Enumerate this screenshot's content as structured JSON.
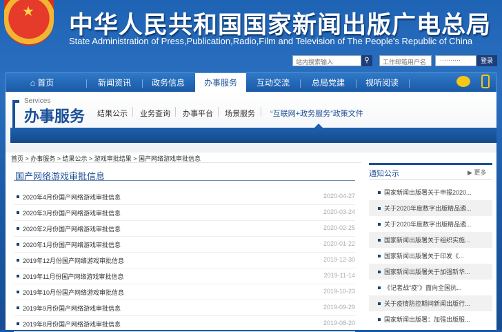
{
  "header": {
    "title_cn": "中华人民共和国国家新闻出版广电总局",
    "title_en": "State Administration of Press,Publication,Radio,Film and Television of The People's Republic of China",
    "search_placeholder": "站内搜索输入",
    "username_placeholder": "工作邮箱用户名",
    "password_value": "··········",
    "login_label": "登录",
    "search_icon": "search-icon"
  },
  "nav": {
    "home": "首页",
    "items": [
      "新闻资讯",
      "政务信息",
      "办事服务",
      "互动交流",
      "总局党建",
      "视听阅读"
    ],
    "active": "办事服务"
  },
  "services": {
    "en": "Services",
    "cn": "办事服务",
    "links": [
      "结果公示",
      "业务查询",
      "办事平台",
      "场景服务",
      "“互联网+政务服务”政策文件"
    ]
  },
  "breadcrumb": "首页 > 办事服务 > 结果公示 > 游戏审批结果 > 国产网络游戏审批信息",
  "main": {
    "title": "国产网络游戏审批信息",
    "items": [
      {
        "title": "2020年4月份国产网络游戏审批信息",
        "date": "2020-04-27"
      },
      {
        "title": "2020年3月份国产网络游戏审批信息",
        "date": "2020-03-24"
      },
      {
        "title": "2020年2月份国产网络游戏审批信息",
        "date": "2020-02-25"
      },
      {
        "title": "2020年1月份国产网络游戏审批信息",
        "date": "2020-01-22"
      },
      {
        "title": "2019年12月份国产网络游戏审批信息",
        "date": "2019-12-30"
      },
      {
        "title": "2019年11月份国产网络游戏审批信息",
        "date": "2019-11-14"
      },
      {
        "title": "2019年10月份国产网络游戏审批信息",
        "date": "2019-10-23"
      },
      {
        "title": "2019年9月份国产网络游戏审批信息",
        "date": "2019-09-29"
      },
      {
        "title": "2019年8月份国产网络游戏审批信息",
        "date": "2019-08-20"
      }
    ]
  },
  "sidebar": {
    "title": "通知公示",
    "more": "▶ 更多",
    "items": [
      "国家新闻出版署关于申报2020...",
      "关于2020年度数字出版精品遴...",
      "关于2020年度数字出版精品遴...",
      "国家新闻出版署关于组织实施...",
      "国家新闻出版署关于印发《...",
      "国家新闻出版署关于加强新华...",
      "《记者战“疫”》面向全国抗...",
      "关于疫情防控期间新闻出版行...",
      "国家新闻出版署：加强出版服..."
    ]
  }
}
